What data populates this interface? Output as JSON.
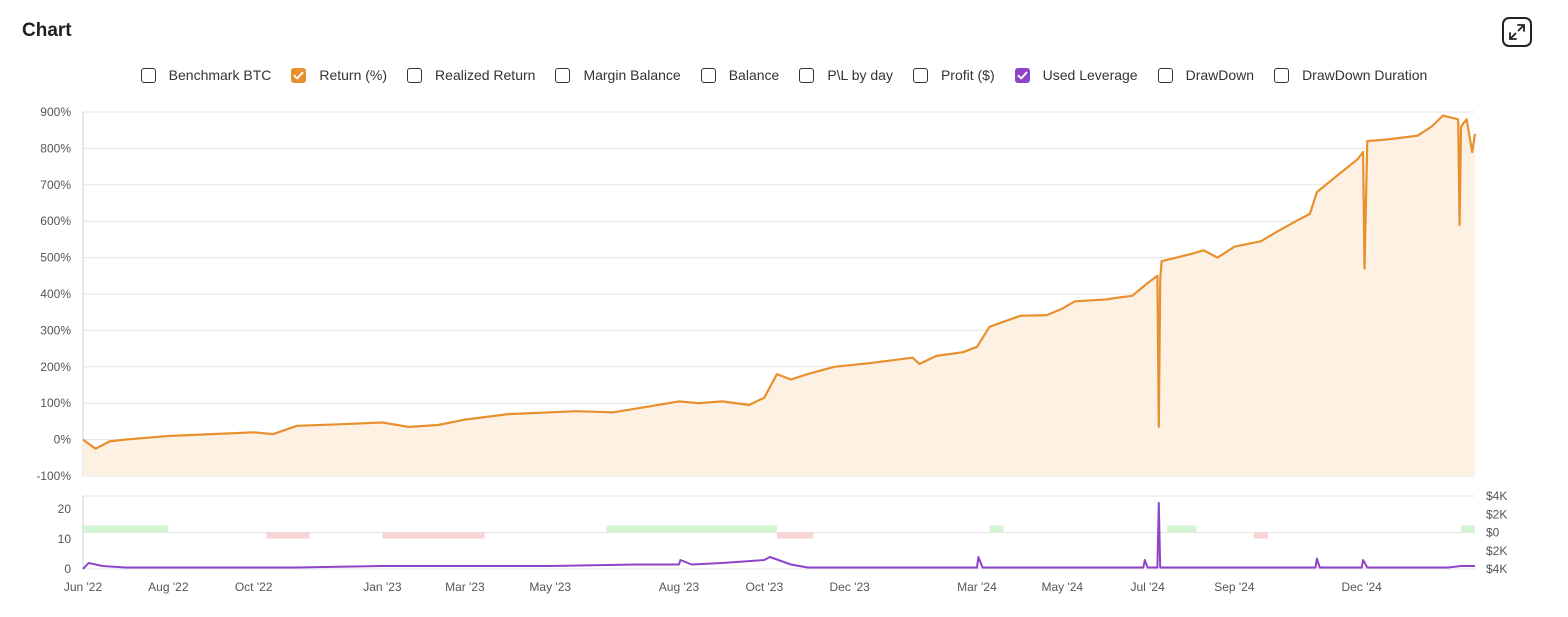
{
  "header": {
    "title": "Chart"
  },
  "legend": {
    "items": [
      {
        "label": "Benchmark BTC",
        "checked": false,
        "color": "#333333"
      },
      {
        "label": "Return (%)",
        "checked": true,
        "color": "#e8902e"
      },
      {
        "label": "Realized Return",
        "checked": false,
        "color": "#333333"
      },
      {
        "label": "Margin Balance",
        "checked": false,
        "color": "#333333"
      },
      {
        "label": "Balance",
        "checked": false,
        "color": "#333333"
      },
      {
        "label": "P\\L by day",
        "checked": false,
        "color": "#333333"
      },
      {
        "label": "Profit ($)",
        "checked": false,
        "color": "#333333"
      },
      {
        "label": "Used Leverage",
        "checked": true,
        "color": "#8e44c9"
      },
      {
        "label": "DrawDown",
        "checked": false,
        "color": "#333333"
      },
      {
        "label": "DrawDown Duration",
        "checked": false,
        "color": "#333333"
      }
    ]
  },
  "colors": {
    "return_line": "#e8902e",
    "return_fill": "#fdf1e3",
    "leverage_line": "#8e44c9",
    "pl_positive": "#c9f2c9",
    "pl_negative": "#f6c9c9",
    "grid": "#e6e6e6"
  },
  "chart_data": [
    {
      "type": "area",
      "series": [
        {
          "name": "Return (%)",
          "x": [
            "2022-06-01",
            "2022-06-10",
            "2022-06-20",
            "2022-07-01",
            "2022-08-01",
            "2022-09-01",
            "2022-10-01",
            "2022-10-15",
            "2022-11-01",
            "2022-12-01",
            "2023-01-01",
            "2023-01-20",
            "2023-02-10",
            "2023-03-01",
            "2023-04-01",
            "2023-05-01",
            "2023-05-20",
            "2023-06-15",
            "2023-07-01",
            "2023-08-01",
            "2023-08-15",
            "2023-09-01",
            "2023-09-20",
            "2023-10-01",
            "2023-10-10",
            "2023-10-20",
            "2023-11-01",
            "2023-11-20",
            "2023-12-15",
            "2024-01-15",
            "2024-01-20",
            "2024-02-01",
            "2024-02-20",
            "2024-03-01",
            "2024-03-10",
            "2024-04-01",
            "2024-04-20",
            "2024-05-01",
            "2024-05-10",
            "2024-06-01",
            "2024-06-10",
            "2024-06-20",
            "2024-07-01",
            "2024-07-08",
            "2024-07-09",
            "2024-07-10",
            "2024-07-11",
            "2024-08-01",
            "2024-08-10",
            "2024-08-20",
            "2024-09-01",
            "2024-09-20",
            "2024-10-01",
            "2024-10-15",
            "2024-10-25",
            "2024-10-30",
            "2024-11-15",
            "2024-11-28",
            "2024-12-02",
            "2024-12-03",
            "2024-12-05",
            "2024-12-20",
            "2025-01-10",
            "2025-01-20",
            "2025-01-28",
            "2025-02-08",
            "2025-02-09",
            "2025-02-10",
            "2025-02-14",
            "2025-02-18",
            "2025-02-20"
          ],
          "values": [
            0,
            -25,
            -5,
            0,
            10,
            15,
            20,
            15,
            38,
            42,
            47,
            35,
            40,
            55,
            70,
            75,
            78,
            75,
            85,
            105,
            100,
            105,
            95,
            115,
            180,
            165,
            180,
            200,
            210,
            225,
            208,
            230,
            240,
            255,
            310,
            340,
            342,
            360,
            380,
            385,
            390,
            395,
            430,
            450,
            35,
            440,
            490,
            510,
            520,
            500,
            530,
            545,
            570,
            600,
            620,
            680,
            730,
            770,
            790,
            470,
            820,
            825,
            835,
            860,
            890,
            880,
            590,
            860,
            880,
            790,
            840
          ]
        }
      ],
      "ylim": [
        -100,
        900
      ],
      "yticks": [
        "900%",
        "800%",
        "700%",
        "600%",
        "500%",
        "400%",
        "300%",
        "200%",
        "100%",
        "0%",
        "-100%"
      ]
    },
    {
      "type": "line",
      "series": [
        {
          "name": "Used Leverage",
          "x": [
            "2022-06-01",
            "2022-06-05",
            "2022-06-15",
            "2022-07-01",
            "2022-09-01",
            "2022-11-01",
            "2023-01-01",
            "2023-03-01",
            "2023-05-01",
            "2023-07-01",
            "2023-08-01",
            "2023-08-02",
            "2023-08-10",
            "2023-09-01",
            "2023-10-01",
            "2023-10-05",
            "2023-10-20",
            "2023-11-01",
            "2023-12-01",
            "2024-01-01",
            "2024-02-01",
            "2024-03-01",
            "2024-03-02",
            "2024-03-05",
            "2024-04-01",
            "2024-05-01",
            "2024-06-01",
            "2024-06-28",
            "2024-06-29",
            "2024-07-01",
            "2024-07-08",
            "2024-07-09",
            "2024-07-10",
            "2024-08-01",
            "2024-09-01",
            "2024-10-01",
            "2024-10-29",
            "2024-10-30",
            "2024-11-01",
            "2024-12-01",
            "2024-12-02",
            "2024-12-05",
            "2025-01-01",
            "2025-02-01",
            "2025-02-10",
            "2025-02-20"
          ],
          "values": [
            0,
            2,
            1,
            0.5,
            0.5,
            0.5,
            1,
            1,
            1,
            1.5,
            1.5,
            3,
            1.5,
            2,
            3,
            4,
            1.5,
            0.5,
            0.5,
            0.5,
            0.5,
            0.5,
            4,
            0.5,
            0.5,
            0.5,
            0.5,
            0.5,
            3,
            0.5,
            0.5,
            22,
            0.5,
            0.5,
            0.5,
            0.5,
            0.5,
            3.5,
            0.5,
            0.5,
            3,
            0.5,
            0.5,
            0.5,
            1,
            1
          ]
        }
      ],
      "ylim": [
        0,
        25
      ],
      "yticks": [
        "20",
        "10",
        "0"
      ],
      "y2ticks": [
        "$4K",
        "$2K",
        "$0",
        "$2K",
        "$4K"
      ]
    }
  ],
  "xaxis": {
    "ticks": [
      "Jun '22",
      "Aug '22",
      "Oct '22",
      "Jan '23",
      "Mar '23",
      "May '23",
      "Aug '23",
      "Oct '23",
      "Dec '23",
      "Mar '24",
      "May '24",
      "Jul '24",
      "Sep '24",
      "Dec '24"
    ]
  },
  "pl_bands": [
    {
      "start": "2022-06-01",
      "end": "2022-08-01",
      "sign": "positive"
    },
    {
      "start": "2022-10-10",
      "end": "2022-11-10",
      "sign": "negative"
    },
    {
      "start": "2023-01-01",
      "end": "2023-03-15",
      "sign": "negative"
    },
    {
      "start": "2023-06-10",
      "end": "2023-10-10",
      "sign": "positive"
    },
    {
      "start": "2023-10-10",
      "end": "2023-11-05",
      "sign": "negative"
    },
    {
      "start": "2024-03-10",
      "end": "2024-03-20",
      "sign": "positive"
    },
    {
      "start": "2024-07-15",
      "end": "2024-08-05",
      "sign": "positive"
    },
    {
      "start": "2024-09-15",
      "end": "2024-09-25",
      "sign": "negative"
    },
    {
      "start": "2025-02-10",
      "end": "2025-02-20",
      "sign": "positive"
    }
  ]
}
